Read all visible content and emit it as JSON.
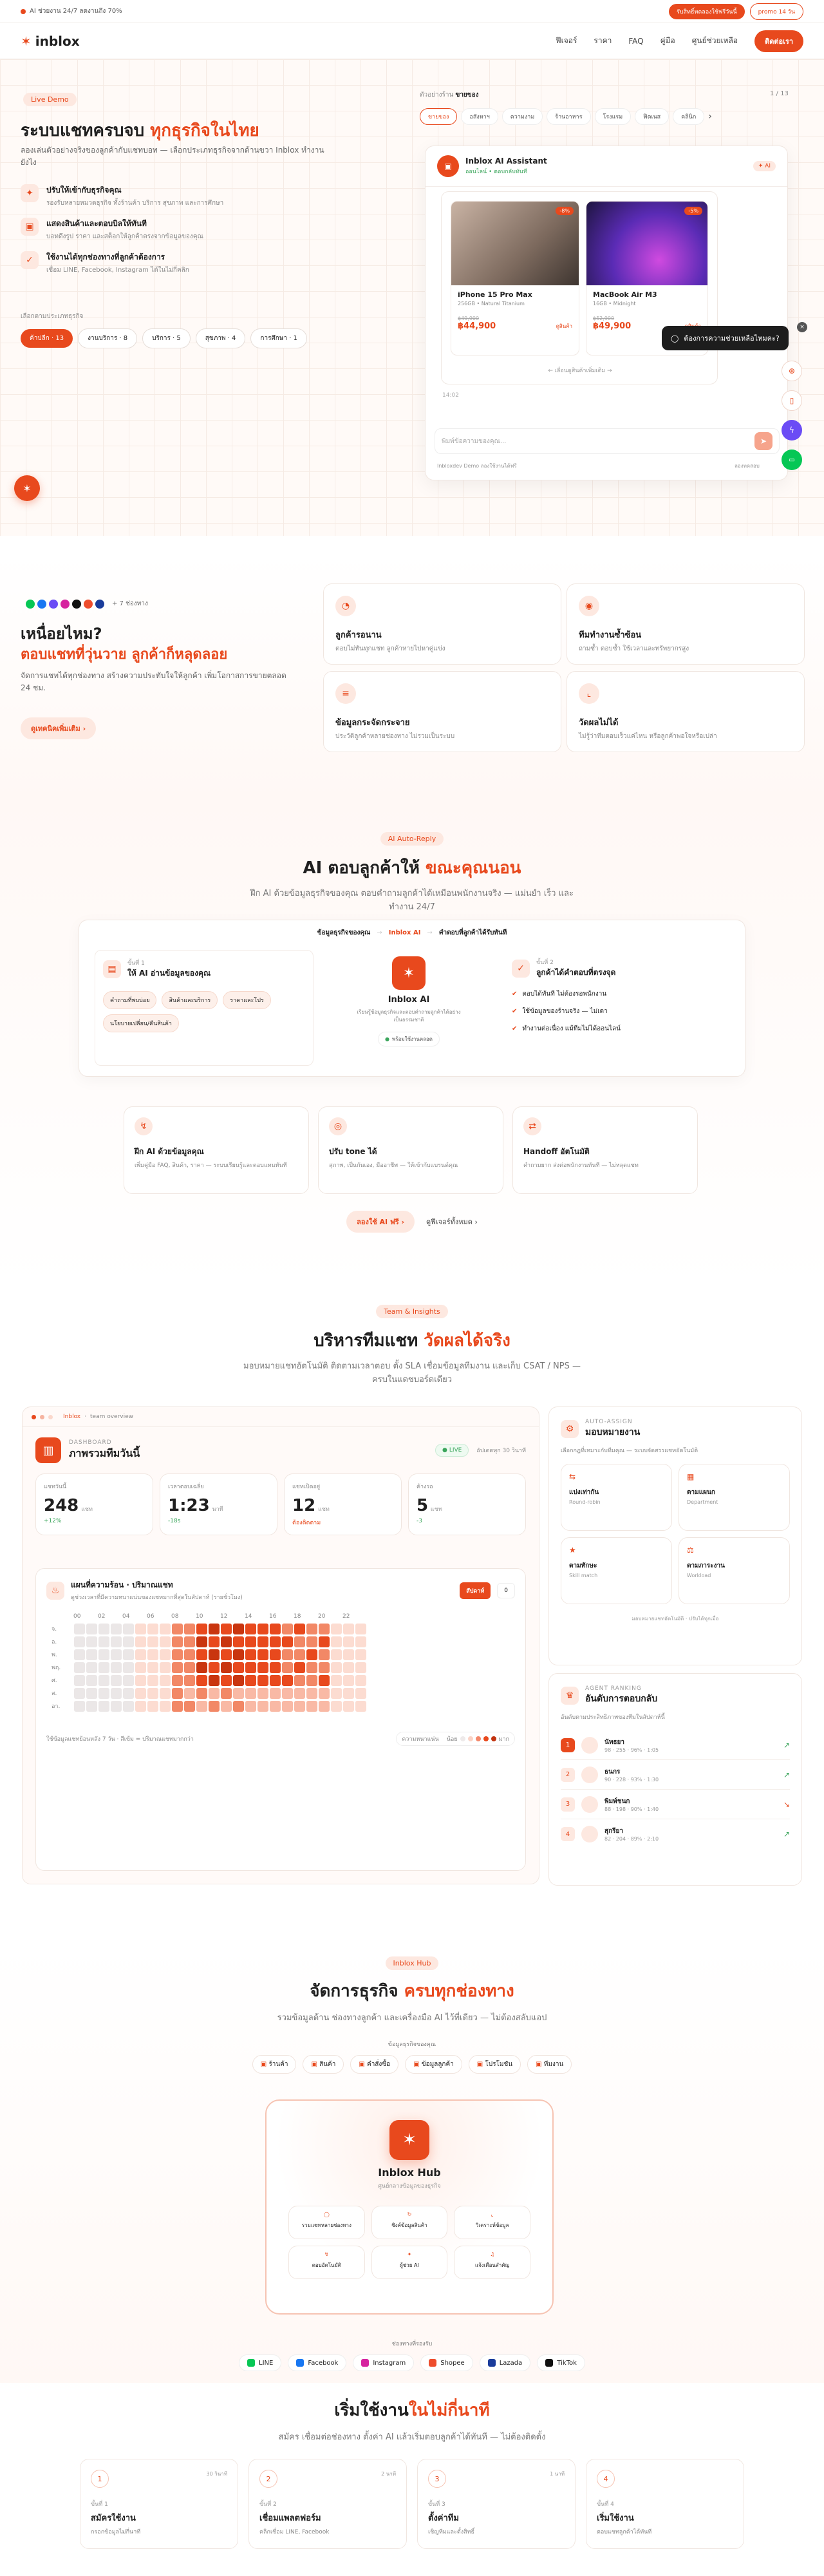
{
  "topbar": {
    "promo": "AI ช่วยงาน 24/7 ลดงานถึง 70%",
    "cta_left": "รับสิทธิ์ทดลองใช้ฟรีวันนี้",
    "cta_right": "promo 14 วัน"
  },
  "nav": {
    "logo": "inblox",
    "items": [
      "ฟีเจอร์",
      "ราคา",
      "FAQ",
      "คู่มือ",
      "ศูนย์ช่วยเหลือ"
    ],
    "signup": "ติดต่อเรา"
  },
  "hero": {
    "tag": "Live Demo",
    "title_a": "ระบบแชทครบจบ ",
    "title_b": "ทุกธุรกิจในไทย",
    "desc": "ลองเล่นตัวอย่างจริงของลูกค้ากับแชทบอท — เลือกประเภทธุรกิจจากด้านขวา Inblox ทำงานยังไง",
    "features": [
      {
        "t": "ปรับให้เข้ากับธุรกิจคุณ",
        "d": "รองรับหลายหมวดธุรกิจ ทั้งร้านค้า บริการ สุขภาพ และการศึกษา"
      },
      {
        "t": "แสดงสินค้าและตอบบิลให้ทันที",
        "d": "บอทดึงรูป ราคา และสต็อกให้ลูกค้าตรงจากข้อมูลของคุณ"
      },
      {
        "t": "ใช้งานได้ทุกช่องทางที่ลูกค้าต้องการ",
        "d": "เชื่อม LINE, Facebook, Instagram ได้ในไม่กี่คลิก"
      }
    ],
    "cat_label": "เลือกตามประเภทธุรกิจ",
    "cats": [
      "ค้าปลีก · 13",
      "งานบริการ · 8",
      "บริการ · 5",
      "สุขภาพ · 4",
      "การศึกษา · 1"
    ]
  },
  "demo": {
    "label": "ตัวอย่างร้าน",
    "shop": "ขายของ",
    "counter": "1 / 13",
    "tabs": [
      "ขายของ",
      "อสังหาฯ",
      "ความงาม",
      "ร้านอาหาร",
      "โรงแรม",
      "ฟิตเนส",
      "คลินิก"
    ],
    "assistant": "Inblox AI Assistant",
    "status": "ออนไลน์ • ตอบกลับทันที",
    "products": [
      {
        "name": "iPhone 15 Pro Max",
        "spec": "256GB • Natural Titanium",
        "old": "฿49,900",
        "price": "฿44,900",
        "badge": "-8%",
        "link": "ดูสินค้า"
      },
      {
        "name": "MacBook Air M3",
        "spec": "16GB • Midnight",
        "old": "฿52,900",
        "price": "฿49,900",
        "badge": "-5%",
        "link": "ดูสินค้า"
      }
    ],
    "more": "← เลื่อนดูสินค้าเพิ่มเติม →",
    "time": "14:02",
    "placeholder": "พิมพ์ข้อความของคุณ...",
    "footer_l": "Inbloxdev Demo ลองใช้งานได้ฟรี",
    "footer_r": "ลองทดสอบ",
    "tooltip": "ต้องการความช่วยเหลือไหมคะ?"
  },
  "pain": {
    "platforms": "+ 7 ช่องทาง",
    "q": "เหนื่อยไหม?",
    "title": "ตอบแชทที่วุ่นวาย ลูกค้าก็หลุดลอย",
    "desc": "จัดการแชทได้ทุกช่องทาง สร้างความประทับใจให้ลูกค้า เพิ่มโอกาสการขายตลอด 24 ชม.",
    "btn": "ดูเทคนิคเพิ่มเติม",
    "cards": [
      {
        "t": "ลูกค้ารอนาน",
        "d": "ตอบไม่ทันทุกแชท ลูกค้าหายไปหาคู่แข่ง"
      },
      {
        "t": "ทีมทำงานซ้ำซ้อน",
        "d": "ถามซ้ำ ตอบซ้ำ ใช้เวลาและทรัพยากรสูง"
      },
      {
        "t": "ข้อมูลกระจัดกระจาย",
        "d": "ประวัติลูกค้าหลายช่องทาง ไม่รวมเป็นระบบ"
      },
      {
        "t": "วัดผลไม่ได้",
        "d": "ไม่รู้ว่าทีมตอบเร็วแค่ไหน หรือลูกค้าพอใจหรือเปล่า"
      }
    ]
  },
  "ai": {
    "tag": "AI Auto-Reply",
    "title_a": "AI ตอบลูกค้าให้ ",
    "title_b": "ขณะคุณนอน",
    "desc": "ฝึก AI ด้วยข้อมูลธุรกิจของคุณ ตอบคำถามลูกค้าได้เหมือนพนักงานจริง — แม่นยำ เร็ว และทำงาน 24/7",
    "flow": [
      "ข้อมูลธุรกิจของคุณ",
      "Inblox AI",
      "คำตอบที่ลูกค้าได้รับทันที"
    ],
    "s1_step": "ขั้นที่ 1",
    "s1_title": "ให้ AI อ่านข้อมูลของคุณ",
    "s1_chips": [
      "คำถามที่พบบ่อย",
      "สินค้าและบริการ",
      "ราคาและโปร",
      "นโยบายเปลี่ยน/คืนสินค้า"
    ],
    "center_title": "Inblox AI",
    "center_desc": "เรียนรู้ข้อมูลธุรกิจและตอบคำถามลูกค้าได้อย่างเป็นธรรมชาติ",
    "center_status": "พร้อมใช้งานตลอด",
    "s2_step": "ขั้นที่ 2",
    "s2_title": "ลูกค้าได้คำตอบที่ตรงจุด",
    "s2_items": [
      "ตอบได้ทันที ไม่ต้องรอพนักงาน",
      "ใช้ข้อมูลของร้านจริง — ไม่เดา",
      "ทำงานต่อเนื่อง แม้ทีมไม่ได้ออนไลน์"
    ],
    "feat": [
      {
        "t": "ฝึก AI ด้วยข้อมูลคุณ",
        "d": "เพิ่มคู่มือ FAQ, สินค้า, ราคา — ระบบเรียนรู้และตอบแทนทันที"
      },
      {
        "t": "ปรับ tone ได้",
        "d": "สุภาพ, เป็นกันเอง, มืออาชีพ — ให้เข้ากับแบรนด์คุณ"
      },
      {
        "t": "Handoff อัตโนมัติ",
        "d": "คำถามยาก ส่งต่อพนักงานทันที — ไม่หลุดแชท"
      }
    ],
    "btn1": "ลองใช้ AI ฟรี",
    "btn2": "ดูฟีเจอร์ทั้งหมด"
  },
  "team": {
    "tag": "Team & Insights",
    "title_a": "บริหารทีมแชท ",
    "title_b": "วัดผลได้จริง",
    "desc": "มอบหมายแชทอัตโนมัติ ติดตามเวลาตอบ ตั้ง SLA เชื่อมข้อมูลทีมงาน และเก็บ CSAT / NPS — ครบในแดชบอร์ดเดียว",
    "crumb": [
      "Inblox",
      "team overview"
    ],
    "dash_tag": "DASHBOARD",
    "dash_title": "ภาพรวมทีมวันนี้",
    "live": "LIVE",
    "refresh": "อัปเดตทุก 30 วินาที",
    "stats": [
      {
        "l": "แชทวันนี้",
        "v": "248",
        "u": "แชท",
        "d": "+12%"
      },
      {
        "l": "เวลาตอบเฉลี่ย",
        "v": "1:23",
        "u": "นาที",
        "d": "-18s"
      },
      {
        "l": "แชทเปิดอยู่",
        "v": "12",
        "u": "แชท",
        "d": "ต้องติดตาม"
      },
      {
        "l": "ค้างรอ",
        "v": "5",
        "u": "แชท",
        "d": "-3"
      }
    ],
    "heat_title": "แผนที่ความร้อน · ปริมาณแชท",
    "heat_desc": "ดูช่วงเวลาที่มีความหนาแน่นของแชทมากที่สุดในสัปดาห์ (รายชั่วโมง)",
    "heat_btn": "สัปดาห์",
    "heat_btn2": "0",
    "hours": [
      "00",
      "02",
      "04",
      "06",
      "08",
      "10",
      "12",
      "14",
      "16",
      "18",
      "20",
      "22"
    ],
    "days": [
      "จ.",
      "อ.",
      "พ.",
      "พฤ.",
      "ศ.",
      "ส.",
      "อา."
    ],
    "heat_note": "ใช้ข้อมูลแชทย้อนหลัง 7 วัน · สีเข้ม = ปริมาณแชทมากกว่า",
    "legend_l": "ความหนาแน่น",
    "legend_lo": "น้อย",
    "legend_hi": "มาก",
    "assign_tag": "AUTO-ASSIGN",
    "assign_title": "มอบหมายงาน",
    "assign_desc": "เลือกกฎที่เหมาะกับทีมคุณ — ระบบจัดสรรแชทอัตโนมัติ",
    "rules": [
      {
        "t": "แบ่งเท่ากัน",
        "d": "Round-robin"
      },
      {
        "t": "ตามแผนก",
        "d": "Department"
      },
      {
        "t": "ตามทักษะ",
        "d": "Skill match"
      },
      {
        "t": "ตามภาระงาน",
        "d": "Workload"
      }
    ],
    "assign_foot": "มอบหมายแชทอัตโนมัติ · ปรับได้ทุกเมื่อ",
    "rank_tag": "AGENT RANKING",
    "rank_title": "อันดับการตอบกลับ",
    "rank_desc": "อันดับตามประสิทธิภาพของทีมในสัปดาห์นี้",
    "agents": [
      {
        "r": "1",
        "n": "นัทธยา",
        "m": "98 · 255 · 96% · 1:05"
      },
      {
        "r": "2",
        "n": "ธนกร",
        "m": "90 · 228 · 93% · 1:30"
      },
      {
        "r": "3",
        "n": "พิมพ์ชนก",
        "m": "88 · 198 · 90% · 1:40"
      },
      {
        "r": "4",
        "n": "สุกรียา",
        "m": "82 · 204 · 89% · 2:10"
      }
    ]
  },
  "hub": {
    "tag": "Inblox Hub",
    "title_a": "จัดการธุรกิจ ",
    "title_b": "ครบทุกช่องทาง",
    "desc": "รวมข้อมูลด้าน ช่องทางลูกค้า และเครื่องมือ AI ไว้ที่เดียว — ไม่ต้องสลับแอป",
    "data_label": "ข้อมูลธุรกิจของคุณ",
    "data_items": [
      "ร้านค้า",
      "สินค้า",
      "คำสั่งซื้อ",
      "ข้อมูลลูกค้า",
      "โปรโมชัน",
      "ทีมงาน"
    ],
    "hub_title": "Inblox Hub",
    "hub_sub": "ศูนย์กลางข้อมูลของธุรกิจ",
    "tools": [
      "รวมแชทหลายช่องทาง",
      "ซิงค์ข้อมูลสินค้า",
      "วิเคราะห์ข้อมูล",
      "ตอบอัตโนมัติ",
      "ผู้ช่วย AI",
      "แจ้งเตือนสำคัญ"
    ],
    "ch_label": "ช่องทางที่รองรับ",
    "channels": [
      "LINE",
      "Facebook",
      "Instagram",
      "Shopee",
      "Lazada",
      "TikTok"
    ]
  },
  "start": {
    "title_a": "เริ่มใช้งาน",
    "title_b": "ในไม่กี่นาที",
    "desc": "สมัคร เชื่อมต่อช่องทาง ตั้งค่า AI แล้วเริ่มตอบลูกค้าได้ทันที — ไม่ต้องติดตั้ง",
    "steps": [
      {
        "n": "1",
        "time": "30 วินาที",
        "s": "ขั้นที่ 1",
        "t": "สมัครใช้งาน",
        "d": "กรอกข้อมูลไม่กี่นาที"
      },
      {
        "n": "2",
        "time": "2 นาที",
        "s": "ขั้นที่ 2",
        "t": "เชื่อมแพลตฟอร์ม",
        "d": "คลิกเชื่อม LINE, Facebook"
      },
      {
        "n": "3",
        "time": "1 นาที",
        "s": "ขั้นที่ 3",
        "t": "ตั้งค่าทีม",
        "d": "เชิญทีมและตั้งสิทธิ์"
      },
      {
        "n": "4",
        "time": "",
        "s": "ขั้นที่ 4",
        "t": "เริ่มใช้งาน",
        "d": "ตอบแชทลูกค้าได้ทันที"
      }
    ]
  },
  "colors": {
    "accent": "#e8491d",
    "accent_soft": "#fde8e0",
    "bg_soft": "#fffaf7"
  }
}
